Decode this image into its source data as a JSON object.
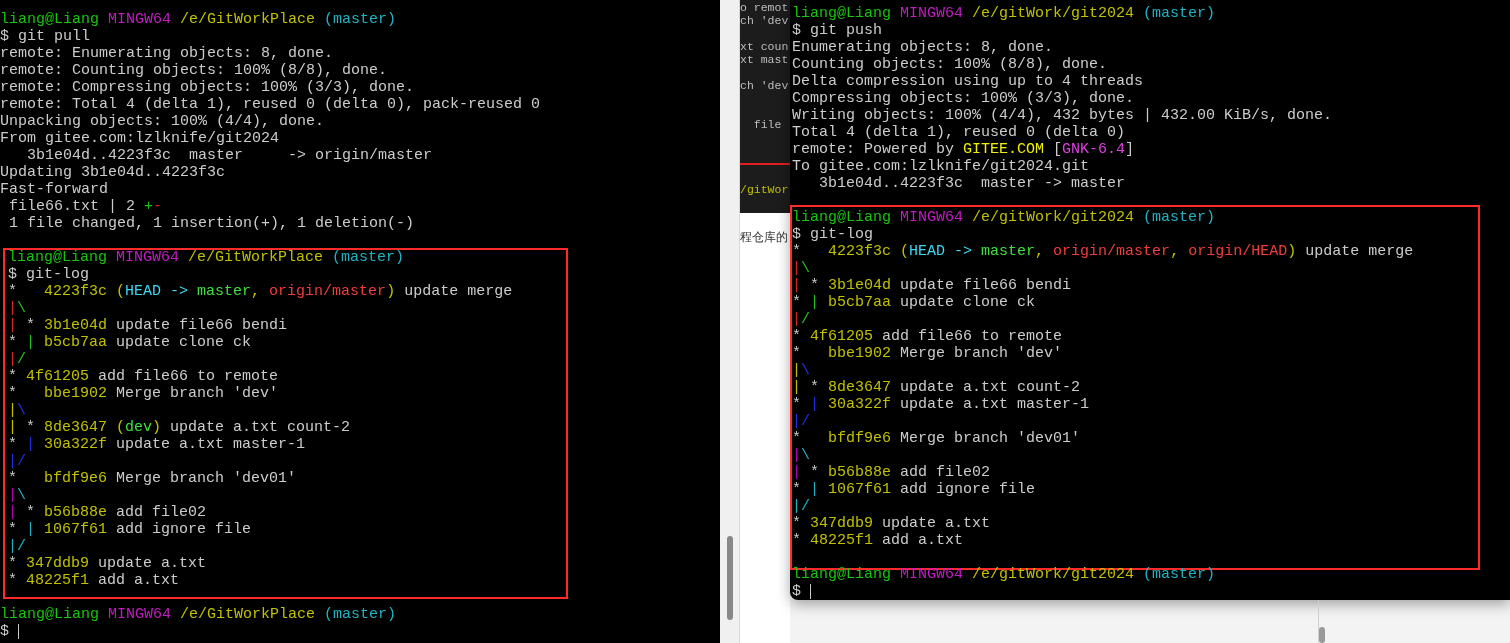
{
  "left_terminal": {
    "blocks": [
      {
        "highlighted": false,
        "lines": [
          {
            "kind": "text",
            "segments": [
              {
                "kind": "user",
                "text": "liang@Liang"
              },
              {
                "kind": "system",
                "text": " MINGW64"
              },
              {
                "kind": "path",
                "text": " /e/GitWorkPlace"
              },
              {
                "kind": "branch",
                "text": " (master)"
              }
            ]
          },
          {
            "kind": "text",
            "segments": [
              {
                "kind": "plain",
                "text": "$ git pull"
              }
            ]
          },
          {
            "kind": "text",
            "segments": [
              {
                "kind": "plain",
                "text": "remote: Enumerating objects: 8, done."
              }
            ]
          },
          {
            "kind": "text",
            "segments": [
              {
                "kind": "plain",
                "text": "remote: Counting objects: 100% (8/8), done."
              }
            ]
          },
          {
            "kind": "text",
            "segments": [
              {
                "kind": "plain",
                "text": "remote: Compressing objects: 100% (3/3), done."
              }
            ]
          },
          {
            "kind": "text",
            "segments": [
              {
                "kind": "plain",
                "text": "remote: Total 4 (delta 1), reused 0 (delta 0), pack-reused 0"
              }
            ]
          },
          {
            "kind": "text",
            "segments": [
              {
                "kind": "plain",
                "text": "Unpacking objects: 100% (4/4), done."
              }
            ]
          },
          {
            "kind": "text",
            "segments": [
              {
                "kind": "plain",
                "text": "From gitee.com:lzlknife/git2024"
              }
            ]
          },
          {
            "kind": "text",
            "segments": [
              {
                "kind": "plain",
                "text": "   3b1e04d..4223f3c  master     -> origin/master"
              }
            ]
          },
          {
            "kind": "text",
            "segments": [
              {
                "kind": "plain",
                "text": "Updating 3b1e04d..4223f3c"
              }
            ]
          },
          {
            "kind": "text",
            "segments": [
              {
                "kind": "plain",
                "text": "Fast-forward"
              }
            ]
          },
          {
            "kind": "text",
            "segments": [
              {
                "kind": "plain",
                "text": " file66.txt | 2 "
              },
              {
                "kind": "plus",
                "text": "+"
              },
              {
                "kind": "minus",
                "text": "-"
              }
            ]
          },
          {
            "kind": "text",
            "segments": [
              {
                "kind": "plain",
                "text": " 1 file changed, 1 insertion(+), 1 deletion(-)"
              }
            ]
          },
          {
            "kind": "blank"
          }
        ]
      },
      {
        "highlighted": true,
        "lines": [
          {
            "kind": "text",
            "segments": [
              {
                "kind": "user",
                "text": "liang@Liang"
              },
              {
                "kind": "system",
                "text": " MINGW64"
              },
              {
                "kind": "path",
                "text": " /e/GitWorkPlace"
              },
              {
                "kind": "branch",
                "text": " (master)"
              }
            ]
          },
          {
            "kind": "text",
            "segments": [
              {
                "kind": "plain",
                "text": "$ git-log"
              }
            ]
          },
          {
            "kind": "text",
            "segments": [
              {
                "kind": "plain",
                "text": "*   "
              },
              {
                "kind": "hash",
                "text": "4223f3c"
              },
              {
                "kind": "hash",
                "text": " ("
              },
              {
                "kind": "head",
                "text": "HEAD -> "
              },
              {
                "kind": "local",
                "text": "master"
              },
              {
                "kind": "hash",
                "text": ", "
              },
              {
                "kind": "remote",
                "text": "origin/master"
              },
              {
                "kind": "hash",
                "text": ")"
              },
              {
                "kind": "plain",
                "text": " update merge"
              }
            ]
          },
          {
            "kind": "text",
            "segments": [
              {
                "kind": "graph-red",
                "text": "|"
              },
              {
                "kind": "graph-green",
                "text": "\\"
              }
            ]
          },
          {
            "kind": "text",
            "segments": [
              {
                "kind": "graph-red",
                "text": "|"
              },
              {
                "kind": "plain",
                "text": " * "
              },
              {
                "kind": "hash",
                "text": "3b1e04d"
              },
              {
                "kind": "plain",
                "text": " update file66 bendi"
              }
            ]
          },
          {
            "kind": "text",
            "segments": [
              {
                "kind": "plain",
                "text": "* "
              },
              {
                "kind": "graph-green",
                "text": "|"
              },
              {
                "kind": "hash",
                "text": " b5cb7aa"
              },
              {
                "kind": "plain",
                "text": " update clone ck"
              }
            ]
          },
          {
            "kind": "text",
            "segments": [
              {
                "kind": "graph-red",
                "text": "|"
              },
              {
                "kind": "graph-green",
                "text": "/"
              }
            ]
          },
          {
            "kind": "text",
            "segments": [
              {
                "kind": "plain",
                "text": "* "
              },
              {
                "kind": "hash",
                "text": "4f61205"
              },
              {
                "kind": "plain",
                "text": " add file66 to remote"
              }
            ]
          },
          {
            "kind": "text",
            "segments": [
              {
                "kind": "plain",
                "text": "*   "
              },
              {
                "kind": "hash",
                "text": "bbe1902"
              },
              {
                "kind": "plain",
                "text": " Merge branch 'dev'"
              }
            ]
          },
          {
            "kind": "text",
            "segments": [
              {
                "kind": "graph-yellow",
                "text": "|"
              },
              {
                "kind": "graph-blue",
                "text": "\\"
              }
            ]
          },
          {
            "kind": "text",
            "segments": [
              {
                "kind": "graph-yellow",
                "text": "|"
              },
              {
                "kind": "plain",
                "text": " * "
              },
              {
                "kind": "hash",
                "text": "8de3647"
              },
              {
                "kind": "hash",
                "text": " ("
              },
              {
                "kind": "local",
                "text": "dev"
              },
              {
                "kind": "hash",
                "text": ")"
              },
              {
                "kind": "plain",
                "text": " update a.txt count-2"
              }
            ]
          },
          {
            "kind": "text",
            "segments": [
              {
                "kind": "plain",
                "text": "* "
              },
              {
                "kind": "graph-blue",
                "text": "|"
              },
              {
                "kind": "hash",
                "text": " 30a322f"
              },
              {
                "kind": "plain",
                "text": " update a.txt master-1"
              }
            ]
          },
          {
            "kind": "text",
            "segments": [
              {
                "kind": "graph-blue",
                "text": "|/"
              }
            ]
          },
          {
            "kind": "text",
            "segments": [
              {
                "kind": "plain",
                "text": "*   "
              },
              {
                "kind": "hash",
                "text": "bfdf9e6"
              },
              {
                "kind": "plain",
                "text": " Merge branch 'dev01'"
              }
            ]
          },
          {
            "kind": "text",
            "segments": [
              {
                "kind": "graph-magenta",
                "text": "|"
              },
              {
                "kind": "graph-cyan",
                "text": "\\"
              }
            ]
          },
          {
            "kind": "text",
            "segments": [
              {
                "kind": "graph-magenta",
                "text": "|"
              },
              {
                "kind": "plain",
                "text": " * "
              },
              {
                "kind": "hash",
                "text": "b56b88e"
              },
              {
                "kind": "plain",
                "text": " add file02"
              }
            ]
          },
          {
            "kind": "text",
            "segments": [
              {
                "kind": "plain",
                "text": "* "
              },
              {
                "kind": "graph-cyan",
                "text": "|"
              },
              {
                "kind": "hash",
                "text": " 1067f61"
              },
              {
                "kind": "plain",
                "text": " add ignore file"
              }
            ]
          },
          {
            "kind": "text",
            "segments": [
              {
                "kind": "graph-cyan",
                "text": "|/"
              }
            ]
          },
          {
            "kind": "text",
            "segments": [
              {
                "kind": "plain",
                "text": "* "
              },
              {
                "kind": "hash",
                "text": "347ddb9"
              },
              {
                "kind": "plain",
                "text": " update a.txt"
              }
            ]
          },
          {
            "kind": "text",
            "segments": [
              {
                "kind": "plain",
                "text": "* "
              },
              {
                "kind": "hash",
                "text": "48225f1"
              },
              {
                "kind": "plain",
                "text": " add a.txt"
              }
            ]
          }
        ]
      },
      {
        "highlighted": false,
        "lines": [
          {
            "kind": "blank"
          },
          {
            "kind": "text",
            "segments": [
              {
                "kind": "user",
                "text": "liang@Liang"
              },
              {
                "kind": "system",
                "text": " MINGW64"
              },
              {
                "kind": "path",
                "text": " /e/GitWorkPlace"
              },
              {
                "kind": "branch",
                "text": " (master)"
              }
            ]
          },
          {
            "kind": "input",
            "segments": [
              {
                "kind": "plain",
                "text": "$"
              }
            ]
          }
        ]
      }
    ]
  },
  "background_window": {
    "lines": [
      {
        "kind": "text",
        "segments": [
          {
            "kind": "dim",
            "text": "o remot"
          }
        ]
      },
      {
        "kind": "text",
        "segments": [
          {
            "kind": "dim",
            "text": "ch 'dev"
          }
        ]
      },
      {
        "kind": "blank"
      },
      {
        "kind": "text",
        "segments": [
          {
            "kind": "dim",
            "text": "xt coun"
          }
        ]
      },
      {
        "kind": "text",
        "segments": [
          {
            "kind": "dim",
            "text": "xt mast"
          }
        ]
      },
      {
        "kind": "blank"
      },
      {
        "kind": "text",
        "segments": [
          {
            "kind": "dim",
            "text": "ch 'dev"
          }
        ]
      },
      {
        "kind": "blank"
      },
      {
        "kind": "blank"
      },
      {
        "kind": "text",
        "segments": [
          {
            "kind": "dim",
            "text": "  file"
          }
        ]
      },
      {
        "kind": "blank"
      },
      {
        "kind": "blank"
      },
      {
        "kind": "rule"
      },
      {
        "kind": "blank"
      },
      {
        "kind": "text",
        "segments": [
          {
            "kind": "path",
            "text": "/gitWor"
          }
        ]
      }
    ]
  },
  "background_page": {
    "text": "程仓库的"
  },
  "right_terminal": {
    "blocks": [
      {
        "highlighted": false,
        "lines": [
          {
            "kind": "text",
            "segments": [
              {
                "kind": "user",
                "text": "liang@Liang"
              },
              {
                "kind": "system",
                "text": " MINGW64"
              },
              {
                "kind": "path",
                "text": " /e/gitWork/git2024"
              },
              {
                "kind": "branch",
                "text": " (master)"
              }
            ]
          },
          {
            "kind": "text",
            "segments": [
              {
                "kind": "plain",
                "text": "$ git push"
              }
            ]
          },
          {
            "kind": "text",
            "segments": [
              {
                "kind": "plain",
                "text": "Enumerating objects: 8, done."
              }
            ]
          },
          {
            "kind": "text",
            "segments": [
              {
                "kind": "plain",
                "text": "Counting objects: 100% (8/8), done."
              }
            ]
          },
          {
            "kind": "text",
            "segments": [
              {
                "kind": "plain",
                "text": "Delta compression using up to 4 threads"
              }
            ]
          },
          {
            "kind": "text",
            "segments": [
              {
                "kind": "plain",
                "text": "Compressing objects: 100% (3/3), done."
              }
            ]
          },
          {
            "kind": "text",
            "segments": [
              {
                "kind": "plain",
                "text": "Writing objects: 100% (4/4), 432 bytes | 432.00 KiB/s, done."
              }
            ]
          },
          {
            "kind": "text",
            "segments": [
              {
                "kind": "plain",
                "text": "Total 4 (delta 1), reused 0 (delta 0)"
              }
            ]
          },
          {
            "kind": "text",
            "segments": [
              {
                "kind": "plain",
                "text": "remote: Powered by "
              },
              {
                "kind": "brand",
                "text": "GITEE.COM"
              },
              {
                "kind": "plain",
                "text": " ["
              },
              {
                "kind": "version",
                "text": "GNK-6.4"
              },
              {
                "kind": "plain",
                "text": "]"
              }
            ]
          },
          {
            "kind": "text",
            "segments": [
              {
                "kind": "plain",
                "text": "To gitee.com:lzlknife/git2024.git"
              }
            ]
          },
          {
            "kind": "text",
            "segments": [
              {
                "kind": "plain",
                "text": "   3b1e04d..4223f3c  master -> master"
              }
            ]
          },
          {
            "kind": "blank"
          }
        ]
      },
      {
        "highlighted": true,
        "lines": [
          {
            "kind": "text",
            "segments": [
              {
                "kind": "user",
                "text": "liang@Liang"
              },
              {
                "kind": "system",
                "text": " MINGW64"
              },
              {
                "kind": "path",
                "text": " /e/gitWork/git2024"
              },
              {
                "kind": "branch",
                "text": " (master)"
              }
            ]
          },
          {
            "kind": "text",
            "segments": [
              {
                "kind": "plain",
                "text": "$ git-log"
              }
            ]
          },
          {
            "kind": "text",
            "segments": [
              {
                "kind": "plain",
                "text": "*   "
              },
              {
                "kind": "hash",
                "text": "4223f3c"
              },
              {
                "kind": "hash",
                "text": " ("
              },
              {
                "kind": "head",
                "text": "HEAD -> "
              },
              {
                "kind": "local",
                "text": "master"
              },
              {
                "kind": "hash",
                "text": ", "
              },
              {
                "kind": "remote",
                "text": "origin/master"
              },
              {
                "kind": "hash",
                "text": ", "
              },
              {
                "kind": "remote",
                "text": "origin/HEAD"
              },
              {
                "kind": "hash",
                "text": ")"
              },
              {
                "kind": "plain",
                "text": " update merge"
              }
            ]
          },
          {
            "kind": "text",
            "segments": [
              {
                "kind": "graph-red",
                "text": "|"
              },
              {
                "kind": "graph-green",
                "text": "\\"
              }
            ]
          },
          {
            "kind": "text",
            "segments": [
              {
                "kind": "graph-red",
                "text": "|"
              },
              {
                "kind": "plain",
                "text": " * "
              },
              {
                "kind": "hash",
                "text": "3b1e04d"
              },
              {
                "kind": "plain",
                "text": " update file66 bendi"
              }
            ]
          },
          {
            "kind": "text",
            "segments": [
              {
                "kind": "plain",
                "text": "* "
              },
              {
                "kind": "graph-green",
                "text": "|"
              },
              {
                "kind": "hash",
                "text": " b5cb7aa"
              },
              {
                "kind": "plain",
                "text": " update clone ck"
              }
            ]
          },
          {
            "kind": "text",
            "segments": [
              {
                "kind": "graph-red",
                "text": "|"
              },
              {
                "kind": "graph-green",
                "text": "/"
              }
            ]
          },
          {
            "kind": "text",
            "segments": [
              {
                "kind": "plain",
                "text": "* "
              },
              {
                "kind": "hash",
                "text": "4f61205"
              },
              {
                "kind": "plain",
                "text": " add file66 to remote"
              }
            ]
          },
          {
            "kind": "text",
            "segments": [
              {
                "kind": "plain",
                "text": "*   "
              },
              {
                "kind": "hash",
                "text": "bbe1902"
              },
              {
                "kind": "plain",
                "text": " Merge branch 'dev'"
              }
            ]
          },
          {
            "kind": "text",
            "segments": [
              {
                "kind": "graph-yellow",
                "text": "|"
              },
              {
                "kind": "graph-blue",
                "text": "\\"
              }
            ]
          },
          {
            "kind": "text",
            "segments": [
              {
                "kind": "graph-yellow",
                "text": "|"
              },
              {
                "kind": "plain",
                "text": " * "
              },
              {
                "kind": "hash",
                "text": "8de3647"
              },
              {
                "kind": "plain",
                "text": " update a.txt count-2"
              }
            ]
          },
          {
            "kind": "text",
            "segments": [
              {
                "kind": "plain",
                "text": "* "
              },
              {
                "kind": "graph-blue",
                "text": "|"
              },
              {
                "kind": "hash",
                "text": " 30a322f"
              },
              {
                "kind": "plain",
                "text": " update a.txt master-1"
              }
            ]
          },
          {
            "kind": "text",
            "segments": [
              {
                "kind": "graph-blue",
                "text": "|/"
              }
            ]
          },
          {
            "kind": "text",
            "segments": [
              {
                "kind": "plain",
                "text": "*   "
              },
              {
                "kind": "hash",
                "text": "bfdf9e6"
              },
              {
                "kind": "plain",
                "text": " Merge branch 'dev01'"
              }
            ]
          },
          {
            "kind": "text",
            "segments": [
              {
                "kind": "graph-magenta",
                "text": "|"
              },
              {
                "kind": "graph-cyan",
                "text": "\\"
              }
            ]
          },
          {
            "kind": "text",
            "segments": [
              {
                "kind": "graph-magenta",
                "text": "|"
              },
              {
                "kind": "plain",
                "text": " * "
              },
              {
                "kind": "hash",
                "text": "b56b88e"
              },
              {
                "kind": "plain",
                "text": " add file02"
              }
            ]
          },
          {
            "kind": "text",
            "segments": [
              {
                "kind": "plain",
                "text": "* "
              },
              {
                "kind": "graph-cyan",
                "text": "|"
              },
              {
                "kind": "hash",
                "text": " 1067f61"
              },
              {
                "kind": "plain",
                "text": " add ignore file"
              }
            ]
          },
          {
            "kind": "text",
            "segments": [
              {
                "kind": "graph-cyan",
                "text": "|/"
              }
            ]
          },
          {
            "kind": "text",
            "segments": [
              {
                "kind": "plain",
                "text": "* "
              },
              {
                "kind": "hash",
                "text": "347ddb9"
              },
              {
                "kind": "plain",
                "text": " update a.txt"
              }
            ]
          },
          {
            "kind": "text",
            "segments": [
              {
                "kind": "plain",
                "text": "* "
              },
              {
                "kind": "hash",
                "text": "48225f1"
              },
              {
                "kind": "plain",
                "text": " add a.txt"
              }
            ]
          },
          {
            "kind": "blank"
          }
        ]
      },
      {
        "highlighted": false,
        "lines": [
          {
            "kind": "text",
            "segments": [
              {
                "kind": "user",
                "text": "liang@Liang"
              },
              {
                "kind": "system",
                "text": " MINGW64"
              },
              {
                "kind": "path",
                "text": " /e/gitWork/git2024"
              },
              {
                "kind": "branch",
                "text": " (master)"
              }
            ]
          },
          {
            "kind": "input",
            "segments": [
              {
                "kind": "plain",
                "text": "$"
              }
            ]
          }
        ]
      }
    ]
  }
}
